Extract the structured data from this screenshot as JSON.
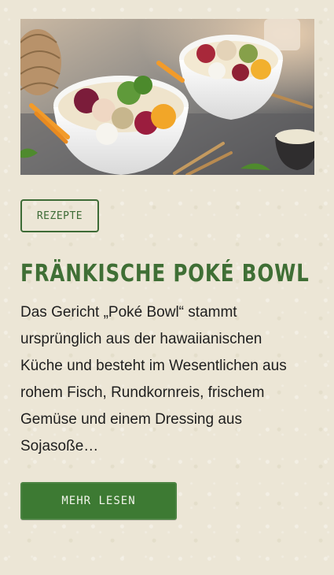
{
  "article": {
    "image_alt": "Fränkische Poké Bowl",
    "category": "REZEPTE",
    "title": "FRÄNKISCHE POKÉ BOWL",
    "description": "Das Gericht „Poké Bowl“ stammt ursprünglich aus der hawaiianischen Küche und besteht im Wesentlichen aus rohem Fisch, Rundkornreis, frischem Gemüse und einem Dressing aus Sojasoße…",
    "cta_label": "MEHR LESEN"
  },
  "colors": {
    "background": "#ece6d6",
    "accent_green": "#3d7a33",
    "title_green": "#3f6f35",
    "text": "#1e1e1e"
  }
}
